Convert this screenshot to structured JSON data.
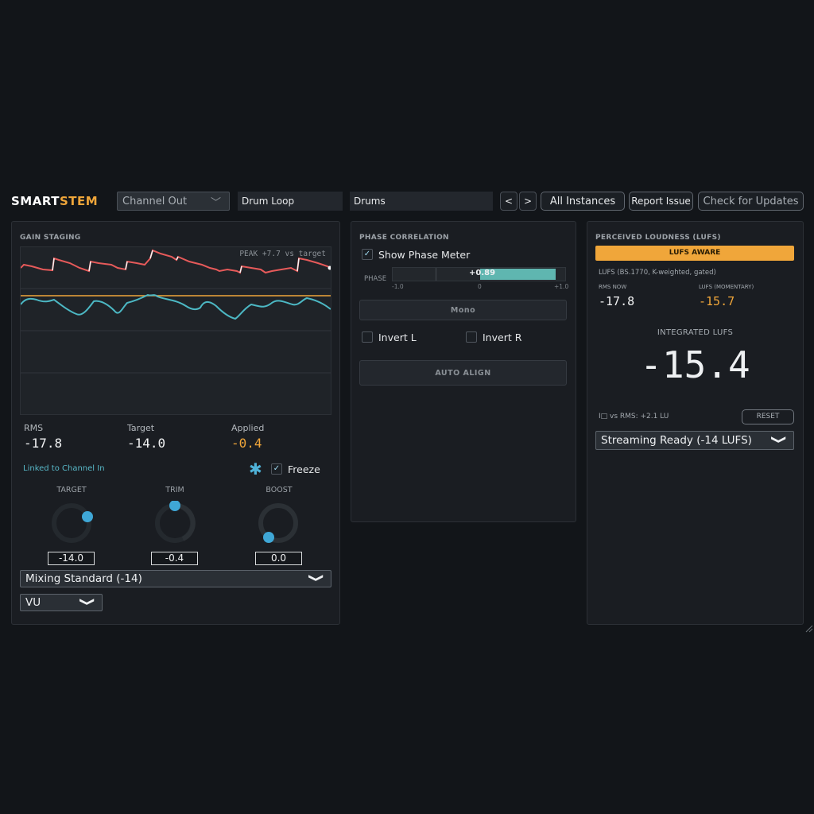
{
  "header": {
    "brand_a": "SMART",
    "brand_b": "STEM",
    "channel_select": "Channel Out",
    "name_field": "Drum Loop",
    "group_field": "Drums",
    "prev_label": "<",
    "next_label": ">",
    "all_instances": "All Instances",
    "report_issue": "Report Issue",
    "check_updates": "Check for Updates"
  },
  "gain": {
    "title": "GAIN STAGING",
    "peak_label": "PEAK +7.7 vs target",
    "rms_label": "RMS",
    "rms_value": "-17.8",
    "target_label": "Target",
    "target_value": "-14.0",
    "applied_label": "Applied",
    "applied_value": "-0.4",
    "linked": "Linked to Channel In",
    "freeze_label": "Freeze",
    "freeze_checked": true,
    "knobs": [
      {
        "label": "TARGET",
        "value": "-14.0",
        "level": 0.75
      },
      {
        "label": "TRIM",
        "value": "-0.4",
        "level": 0.5
      },
      {
        "label": "BOOST",
        "value": "0.0",
        "level": 0.0
      }
    ],
    "standard_select": "Mixing Standard (-14)",
    "meter_select": "VU"
  },
  "phase": {
    "title": "PHASE CORRELATION",
    "show_label": "Show Phase Meter",
    "show_checked": true,
    "phase_label": "PHASE",
    "phase_value": "+0.89",
    "phase_numeric": 0.89,
    "tick_min": "-1.0",
    "tick_mid": "0",
    "tick_max": "+1.0",
    "mono": "Mono",
    "invert_l": "Invert L",
    "invert_r": "Invert R",
    "auto_align": "AUTO ALIGN"
  },
  "loudness": {
    "title": "PERCEIVED LOUDNESS (LUFS)",
    "badge": "LUFS AWARE",
    "desc": "LUFS (BS.1770, K-weighted, gated)",
    "rms_now_label": "RMS NOW",
    "rms_now_value": "-17.8",
    "momentary_label": "LUFS (MOMENTARY)",
    "momentary_value": "-15.7",
    "integrated_label": "INTEGRATED LUFS",
    "integrated_value": "-15.4",
    "vs_rms": "I□ vs RMS: +2.1 LU",
    "reset": "RESET",
    "preset_select": "Streaming Ready (-14 LUFS)"
  },
  "colors": {
    "accent": "#f0a63a",
    "peak_line": "#e65a5a",
    "rms_line": "#4cb8c4",
    "target_line": "#f0a63a",
    "knob": "#3fa7d6",
    "phase_fill": "#5fb6b0"
  }
}
